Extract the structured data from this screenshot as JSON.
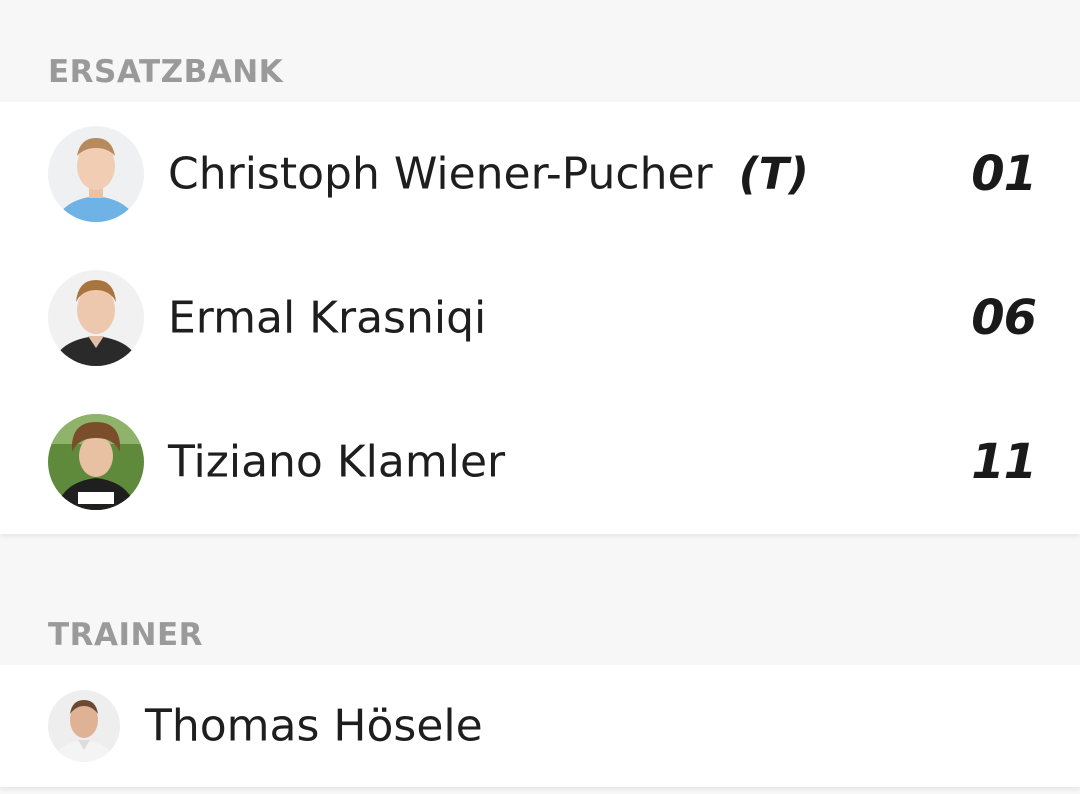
{
  "bench": {
    "header": "ERSATZBANK",
    "players": [
      {
        "name": "Christoph Wiener-Pucher",
        "role": "(T)",
        "number": "01",
        "avatar_icon": "player-photo-icon"
      },
      {
        "name": "Ermal Krasniqi",
        "role": "",
        "number": "06",
        "avatar_icon": "player-photo-icon"
      },
      {
        "name": "Tiziano Klamler",
        "role": "",
        "number": "11",
        "avatar_icon": "player-photo-icon"
      }
    ]
  },
  "trainer": {
    "header": "TRAINER",
    "name": "Thomas Hösele",
    "avatar_icon": "trainer-photo-icon"
  },
  "colors": {
    "background": "#f7f7f7",
    "card": "#ffffff",
    "header_text": "#9a9a9a",
    "text": "#1e1e1e"
  }
}
